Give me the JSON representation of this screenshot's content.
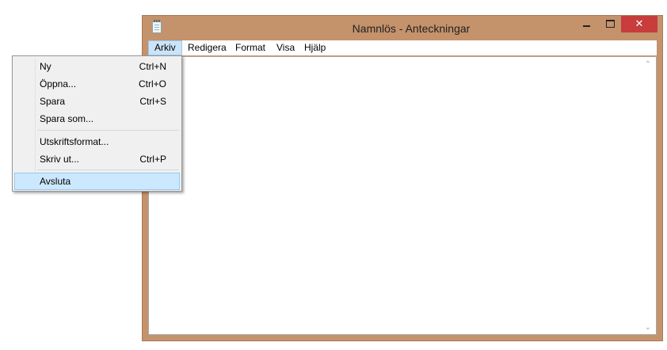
{
  "window": {
    "title": "Namnlös - Anteckningar",
    "controls": {
      "minimize": "minimize",
      "maximize": "maximize",
      "close": "✕"
    }
  },
  "menubar": {
    "items": [
      {
        "label": "Arkiv",
        "active": true
      },
      {
        "label": "Redigera"
      },
      {
        "label": "Format"
      },
      {
        "label": "Visa"
      },
      {
        "label": "Hjälp"
      }
    ]
  },
  "file_menu": {
    "items": [
      {
        "label": "Ny",
        "shortcut": "Ctrl+N"
      },
      {
        "label": "Öppna...",
        "shortcut": "Ctrl+O"
      },
      {
        "label": "Spara",
        "shortcut": "Ctrl+S"
      },
      {
        "label": "Spara som...",
        "shortcut": ""
      },
      {
        "label": "Utskriftsformat...",
        "shortcut": ""
      },
      {
        "label": "Skriv ut...",
        "shortcut": "Ctrl+P"
      },
      {
        "label": "Avsluta",
        "shortcut": "",
        "highlighted": true
      }
    ]
  },
  "colors": {
    "window_frame": "#c4926b",
    "close_button": "#c83c3c",
    "menu_highlight": "#cce8ff"
  },
  "icons": {
    "app": "notepad-icon",
    "scroll_up": "chevron-up-icon",
    "scroll_down": "chevron-down-icon"
  }
}
